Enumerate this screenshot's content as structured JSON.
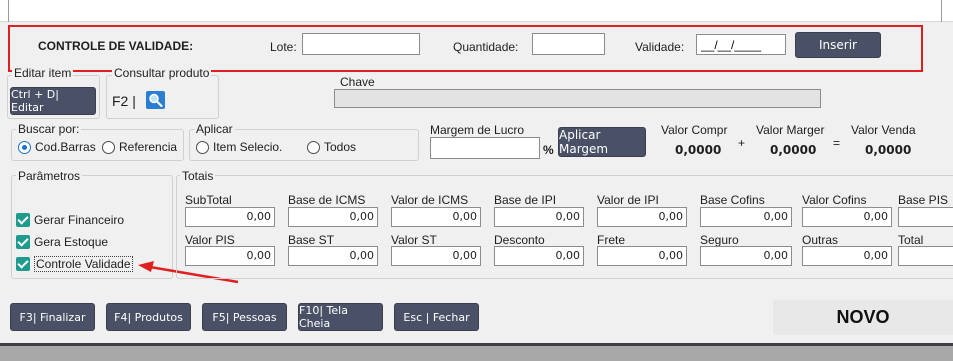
{
  "validade_row": {
    "title": "CONTROLE DE VALIDADE:",
    "lote_label": "Lote:",
    "lote_value": "",
    "quantidade_label": "Quantidade:",
    "quantidade_value": "",
    "validade_label": "Validade:",
    "validade_value": "__/__/____",
    "inserir_label": "Inserir"
  },
  "editar_item": {
    "title": "Editar item",
    "button_label": "Ctrl + D| Editar"
  },
  "consultar_produto": {
    "title": "Consultar produto",
    "shortcut": "F2 |",
    "icon": "search-icon"
  },
  "chave": {
    "label": "Chave",
    "value": ""
  },
  "buscar_por": {
    "title": "Buscar por:",
    "options": [
      "Cod.Barras",
      "Referencia"
    ],
    "selected": "Cod.Barras"
  },
  "aplicar": {
    "title": "Aplicar",
    "options": [
      "Item Selecio.",
      "Todos"
    ]
  },
  "margem": {
    "label": "Margem de Lucro",
    "value": "",
    "percent": "%",
    "button_label": "Aplicar Margem"
  },
  "valores": {
    "compra_label": "Valor Compr",
    "compra_value": "0,0000",
    "plus": "+",
    "margem_label": "Valor Marger",
    "margem_value": "0,0000",
    "equals": "=",
    "venda_label": "Valor Venda",
    "venda_value": "0,0000"
  },
  "parametros": {
    "title": "Parâmetros",
    "items": [
      {
        "label": "Gerar Financeiro",
        "checked": true
      },
      {
        "label": "Gera Estoque",
        "checked": true
      },
      {
        "label": "Controle Validade",
        "checked": true
      }
    ]
  },
  "totais": {
    "title": "Totais",
    "row1": [
      {
        "label": "SubTotal",
        "value": "0,00"
      },
      {
        "label": "Base de ICMS",
        "value": "0,00"
      },
      {
        "label": "Valor de ICMS",
        "value": "0,00"
      },
      {
        "label": "Base de IPI",
        "value": "0,00"
      },
      {
        "label": "Valor de IPI",
        "value": "0,00"
      },
      {
        "label": "Base Cofins",
        "value": "0,00"
      },
      {
        "label": "Valor Cofins",
        "value": "0,00"
      },
      {
        "label": "Base PIS",
        "value": ""
      }
    ],
    "row2": [
      {
        "label": "Valor PIS",
        "value": "0,00"
      },
      {
        "label": "Base ST",
        "value": "0,00"
      },
      {
        "label": "Valor ST",
        "value": "0,00"
      },
      {
        "label": "Desconto",
        "value": "0,00"
      },
      {
        "label": "Frete",
        "value": "0,00"
      },
      {
        "label": "Seguro",
        "value": "0,00"
      },
      {
        "label": "Outras",
        "value": "0,00"
      },
      {
        "label": "Total",
        "value": ""
      }
    ]
  },
  "footer": {
    "buttons": [
      "F3| Finalizar",
      "F4| Produtos",
      "F5| Pessoas",
      "F10| Tela Cheia",
      "Esc | Fechar"
    ],
    "status": "NOVO"
  },
  "colors": {
    "highlight_border": "#e02020",
    "arrow": "#e02020",
    "dark_button": "#4a5066",
    "checkbox": "#1e9a8e",
    "radio_selected": "#1a73c8"
  }
}
